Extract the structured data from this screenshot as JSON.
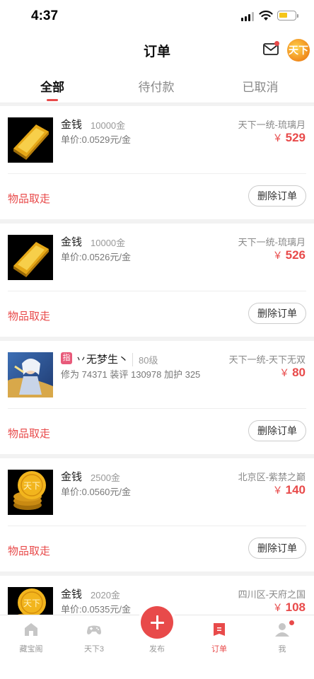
{
  "status_bar": {
    "time": "4:37"
  },
  "header": {
    "title": "订单",
    "avatar_text": "天下"
  },
  "tabs": [
    {
      "label": "全部",
      "active": true
    },
    {
      "label": "待付款",
      "active": false
    },
    {
      "label": "已取消",
      "active": false
    }
  ],
  "orders": [
    {
      "name": "金钱",
      "qty": "10000金",
      "sub": "单价:0.0529元/金",
      "server": "天下一统-琉璃月",
      "price": "529",
      "status": "物品取走",
      "action": "删除订单",
      "thumb": "gold-bar"
    },
    {
      "name": "金钱",
      "qty": "10000金",
      "sub": "单价:0.0526元/金",
      "server": "天下一统-琉璃月",
      "price": "526",
      "status": "物品取走",
      "action": "删除订单",
      "thumb": "gold-bar"
    },
    {
      "badge": "指",
      "name": "丷无梦生丶",
      "qty": "80级",
      "sub": "修为 74371  装评 130978  加护 325",
      "server": "天下一统-天下无双",
      "price": "80",
      "status": "物品取走",
      "action": "删除订单",
      "thumb": "character"
    },
    {
      "name": "金钱",
      "qty": "2500金",
      "sub": "单价:0.0560元/金",
      "server": "北京区-紫禁之巅",
      "price": "140",
      "status": "物品取走",
      "action": "删除订单",
      "thumb": "gold-coins"
    },
    {
      "name": "金钱",
      "qty": "2020金",
      "sub": "单价:0.0535元/金",
      "server": "四川区-天府之国",
      "price": "108",
      "thumb": "gold-coins"
    }
  ],
  "currency_symbol": "￥",
  "coin_text": "天下",
  "bottom_nav": [
    {
      "label": "藏宝阁",
      "icon": "home-icon"
    },
    {
      "label": "天下3",
      "icon": "gamepad-icon"
    },
    {
      "label": "发布",
      "icon": "plus-icon"
    },
    {
      "label": "订单",
      "icon": "order-icon",
      "active": true
    },
    {
      "label": "我",
      "icon": "user-icon"
    }
  ],
  "colors": {
    "accent": "#e84a4a",
    "badge": "#e85a7a"
  }
}
